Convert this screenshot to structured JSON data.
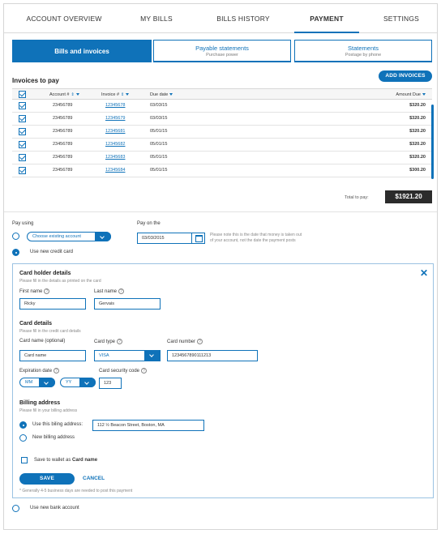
{
  "nav": {
    "tabs": [
      "ACCOUNT OVERVIEW",
      "MY BILLS",
      "BILLS HISTORY",
      "PAYMENT",
      "SETTINGS"
    ],
    "active": "PAYMENT"
  },
  "subtabs": [
    {
      "label": "Bills and invoices",
      "sub": ""
    },
    {
      "label": "Payable statements",
      "sub": "Purchase power"
    },
    {
      "label": "Statements",
      "sub": "Postage by phone"
    }
  ],
  "invoices": {
    "title": "Invoices to pay",
    "add_button": "ADD INVOICES",
    "columns": {
      "account": "Account #",
      "invoice": "Invoice #",
      "due": "Due date",
      "amount": "Amount Due"
    },
    "rows": [
      {
        "account": "23456789",
        "invoice": "12345678",
        "due": "03/03/15",
        "amount": "$320.20"
      },
      {
        "account": "23456789",
        "invoice": "12345679",
        "due": "03/03/15",
        "amount": "$320.20"
      },
      {
        "account": "23456789",
        "invoice": "12345681",
        "due": "05/01/15",
        "amount": "$320.20"
      },
      {
        "account": "23456789",
        "invoice": "12345682",
        "due": "05/01/15",
        "amount": "$320.20"
      },
      {
        "account": "23456789",
        "invoice": "12345683",
        "due": "05/01/15",
        "amount": "$320.20"
      },
      {
        "account": "23456789",
        "invoice": "12345684",
        "due": "05/01/15",
        "amount": "$300.20"
      }
    ],
    "total_label": "Total to pay:",
    "total_value": "$1921.20"
  },
  "pay": {
    "pay_using_label": "Pay using",
    "existing_account": "Choose existing account",
    "new_card": "Use new credit card",
    "pay_on_label": "Pay on the",
    "date": "03/03/2015",
    "date_note_1": "Please note this is the date that money is taken out",
    "date_note_2": "of your account, not the date the payment posts"
  },
  "card": {
    "holder_title": "Card holder details",
    "holder_help": "Please fill in the details as printed on the card",
    "first_name_label": "First name",
    "first_name": "Ricky",
    "last_name_label": "Last name",
    "last_name": "Gervais",
    "details_title": "Card details",
    "details_help": "Please fill in the credit card details",
    "card_name_label": "Card name (optional)",
    "card_name": "Card name",
    "card_type_label": "Card type",
    "card_type": "VISA",
    "card_number_label": "Card number",
    "card_number": "1234567890111213",
    "expiration_label": "Expiration date",
    "mm": "MM",
    "yy": "YY",
    "security_label": "Card security code",
    "security_code": "123",
    "billing_title": "Billing address",
    "billing_help": "Please fill in your billing address",
    "use_billing_label": "Use this biling address:",
    "billing_address": "112 ½ Beacon Street, Boston, MA",
    "new_billing": "New billing address",
    "save_wallet_prefix": "Save to wallet as ",
    "save_wallet_name": "Card name",
    "save_button": "SAVE",
    "cancel_button": "CANCEL",
    "footnote": "* Generally 4-5 business days are needed to post this payment"
  },
  "bank": {
    "label": "Use new bank account"
  },
  "colors": {
    "accent": "#0f72b9",
    "total_bg": "#2c2c2c"
  }
}
